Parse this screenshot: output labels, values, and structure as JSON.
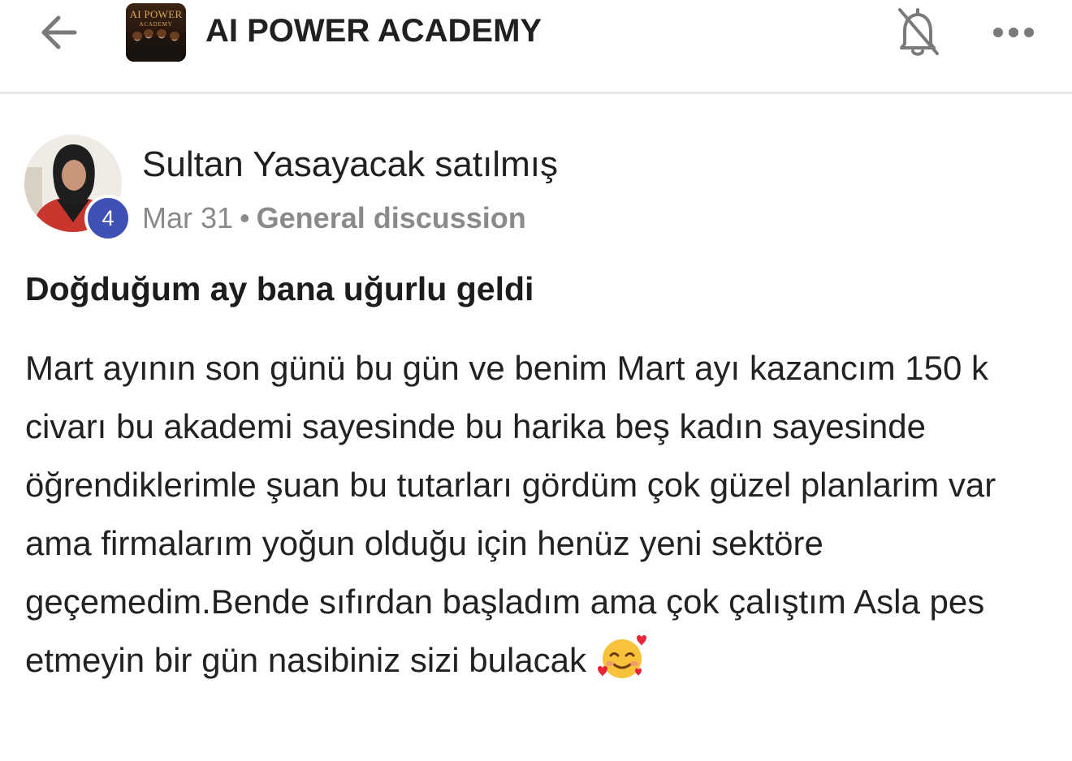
{
  "header": {
    "logo": {
      "line1": "AI POWER",
      "line2": "ACADEMY"
    },
    "group_title": "AI POWER ACADEMY",
    "icons": {
      "back": "arrow-back-icon",
      "notifications": "bell-off-icon",
      "more": "more-horizontal-icon"
    }
  },
  "post": {
    "author": {
      "name": "Sultan Yasayacak satılmış",
      "level": "4"
    },
    "date": "Mar 31",
    "separator": "•",
    "category": "General discussion",
    "title": "Doğduğum ay bana uğurlu geldi",
    "body": "Mart ayının son günü bu gün ve benim Mart ayı kazancım 150 k civarı bu akademi sayesinde bu harika beş kadın sayesinde öğrendiklerimle şuan bu tutarları gördüm çok güzel planlarim var ama firmalarım yoğun olduğu için henüz yeni sektöre geçemedim.Bende sıfırdan başladım ama çok çalıştım Asla pes etmeyin bir gün nasibiniz sizi bulacak",
    "emoji": "smiling-face-with-hearts-icon"
  },
  "colors": {
    "badge": "#3f51b5",
    "meta_text": "#8a8a8a",
    "divider": "#e6e6e6"
  }
}
